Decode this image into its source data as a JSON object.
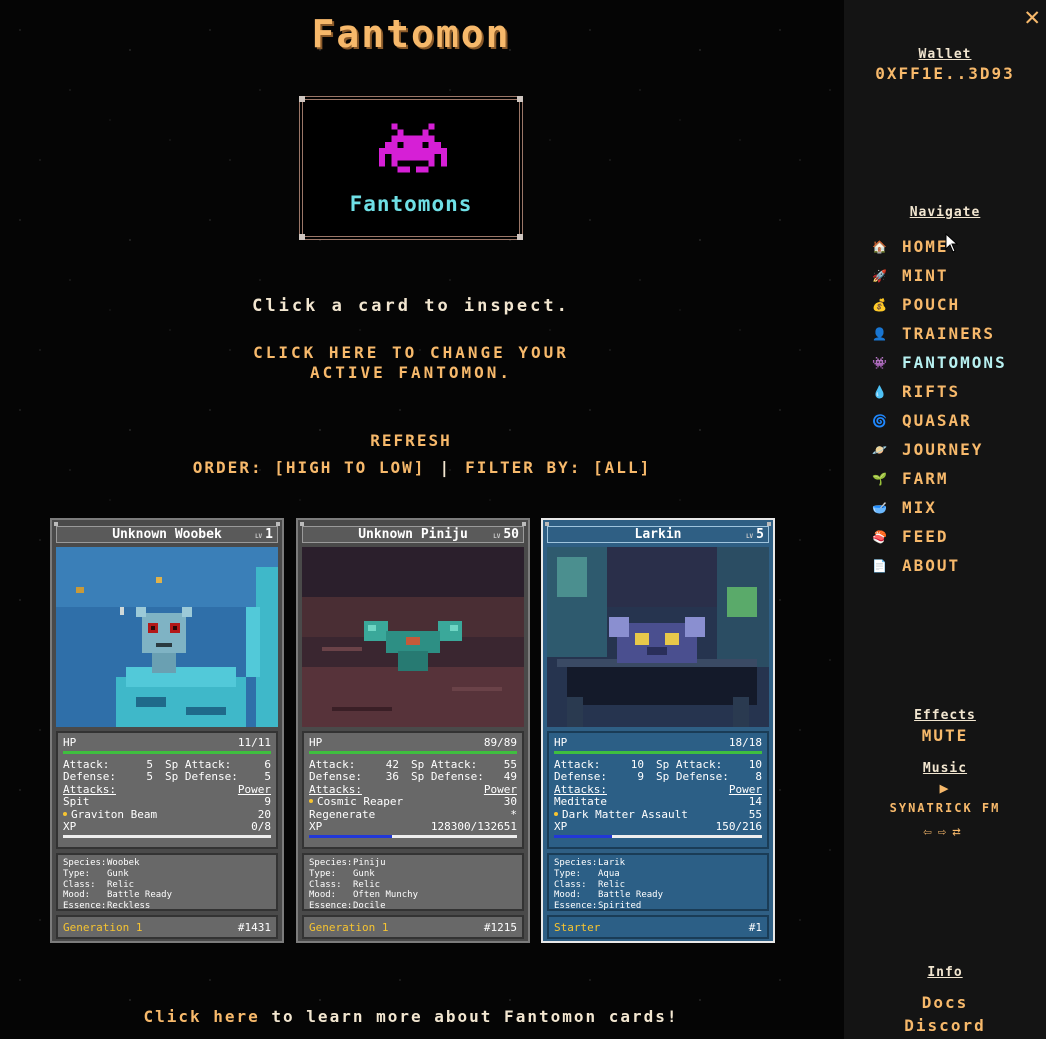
{
  "title": "Fantomon",
  "logo": {
    "label": "Fantomons",
    "icon": "space-invader-icon"
  },
  "instruction": "Click a card to inspect.",
  "change_active": "CLICK HERE TO CHANGE YOUR ACTIVE FANTOMON.",
  "refresh": "REFRESH",
  "order": "ORDER: [HIGH TO LOW]",
  "order_sep": "|",
  "filter": "FILTER BY: [ALL]",
  "cards": [
    {
      "name": "Unknown Woobek",
      "lv_label": "LV",
      "level": "1",
      "hp_label": "HP",
      "hp": "11/11",
      "hp_frac": 1.0,
      "atk_label": "Attack:",
      "atk": "5",
      "spatk_label": "Sp Attack:",
      "spatk": "6",
      "def_label": "Defense:",
      "def": "5",
      "spdef_label": "Sp Defense:",
      "spdef": "5",
      "attacks_label": "Attacks:",
      "power_label": "Power",
      "moves": [
        {
          "name": "Spit",
          "power": "9",
          "active": false
        },
        {
          "name": "Graviton Beam",
          "power": "20",
          "active": true
        }
      ],
      "xp_label": "XP",
      "xp": "0/8",
      "xp_frac": 0.0,
      "species": "Woobek",
      "type": "Gunk",
      "class": "Relic",
      "mood": "Battle Ready",
      "essence": "Reckless",
      "species_label": "Species:",
      "type_label": "Type:",
      "class_label": "Class:",
      "mood_label": "Mood:",
      "essence_label": "Essence:",
      "foot_left": "Generation 1",
      "foot_right": "#1431"
    },
    {
      "name": "Unknown Piniju",
      "lv_label": "LV",
      "level": "50",
      "hp_label": "HP",
      "hp": "89/89",
      "hp_frac": 1.0,
      "atk_label": "Attack:",
      "atk": "42",
      "spatk_label": "Sp Attack:",
      "spatk": "55",
      "def_label": "Defense:",
      "def": "36",
      "spdef_label": "Sp Defense:",
      "spdef": "49",
      "attacks_label": "Attacks:",
      "power_label": "Power",
      "moves": [
        {
          "name": "Cosmic Reaper",
          "power": "30",
          "active": true
        },
        {
          "name": "Regenerate",
          "power": "*",
          "active": false
        }
      ],
      "xp_label": "XP",
      "xp": "128300/132651",
      "xp_frac": 0.4,
      "species": "Piniju",
      "type": "Gunk",
      "class": "Relic",
      "mood": "Often Munchy",
      "essence": "Docile",
      "species_label": "Species:",
      "type_label": "Type:",
      "class_label": "Class:",
      "mood_label": "Mood:",
      "essence_label": "Essence:",
      "foot_left": "Generation 1",
      "foot_right": "#1215"
    },
    {
      "name": "Larkin",
      "lv_label": "LV",
      "level": "5",
      "hp_label": "HP",
      "hp": "18/18",
      "hp_frac": 1.0,
      "atk_label": "Attack:",
      "atk": "10",
      "spatk_label": "Sp Attack:",
      "spatk": "10",
      "def_label": "Defense:",
      "def": "9",
      "spdef_label": "Sp Defense:",
      "spdef": "8",
      "attacks_label": "Attacks:",
      "power_label": "Power",
      "moves": [
        {
          "name": "Meditate",
          "power": "14",
          "active": false
        },
        {
          "name": "Dark Matter Assault",
          "power": "55",
          "active": true
        }
      ],
      "xp_label": "XP",
      "xp": "150/216",
      "xp_frac": 0.28,
      "species": "Larik",
      "type": "Aqua",
      "class": "Relic",
      "mood": "Battle Ready",
      "essence": "Spirited",
      "species_label": "Species:",
      "type_label": "Type:",
      "class_label": "Class:",
      "mood_label": "Mood:",
      "essence_label": "Essence:",
      "foot_left": "Starter",
      "foot_right": "#1"
    }
  ],
  "learn": {
    "pre": "Click here",
    "post": " to learn more about Fantomon cards!"
  },
  "sidebar": {
    "close": "✕",
    "wallet_heading": "Wallet",
    "wallet_address": "0XFF1E..3D93",
    "navigate_heading": "Navigate",
    "nav": [
      {
        "label": "HOME",
        "icon": "house-icon",
        "glyph": "🏠",
        "current": false
      },
      {
        "label": "MINT",
        "icon": "rocket-icon",
        "glyph": "🚀",
        "current": false
      },
      {
        "label": "POUCH",
        "icon": "money-bag-icon",
        "glyph": "💰",
        "current": false
      },
      {
        "label": "TRAINERS",
        "icon": "person-icon",
        "glyph": "👤",
        "current": false
      },
      {
        "label": "FANTOMONS",
        "icon": "invader-icon",
        "glyph": "👾",
        "current": true
      },
      {
        "label": "RIFTS",
        "icon": "drop-icon",
        "glyph": "💧",
        "current": false
      },
      {
        "label": "QUASAR",
        "icon": "swirl-icon",
        "glyph": "🌀",
        "current": false
      },
      {
        "label": "JOURNEY",
        "icon": "planet-icon",
        "glyph": "🪐",
        "current": false
      },
      {
        "label": "FARM",
        "icon": "sprout-icon",
        "glyph": "🌱",
        "current": false
      },
      {
        "label": "MIX",
        "icon": "bowl-icon",
        "glyph": "🥣",
        "current": false
      },
      {
        "label": "FEED",
        "icon": "food-icon",
        "glyph": "🍣",
        "current": false
      },
      {
        "label": "ABOUT",
        "icon": "document-icon",
        "glyph": "📄",
        "current": false
      }
    ],
    "effects_heading": "Effects",
    "mute": "MUTE",
    "music_heading": "Music",
    "play": "▶",
    "station": "SYNATRICK FM",
    "prev": "⇦",
    "next": "⇨",
    "shuffle": "⇄",
    "info_heading": "Info",
    "docs": "Docs",
    "discord": "Discord"
  },
  "colors": {
    "accent": "#f7b96b",
    "cyan": "#6fe0e6",
    "card_active": "#2f5f84",
    "card_grey": "#686868"
  }
}
